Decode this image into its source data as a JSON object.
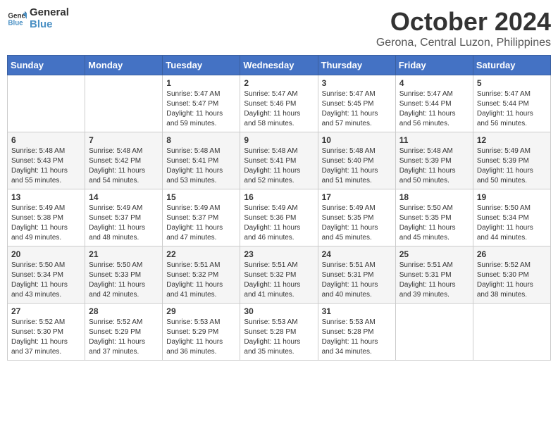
{
  "logo": {
    "line1": "General",
    "line2": "Blue"
  },
  "title": "October 2024",
  "location": "Gerona, Central Luzon, Philippines",
  "days_of_week": [
    "Sunday",
    "Monday",
    "Tuesday",
    "Wednesday",
    "Thursday",
    "Friday",
    "Saturday"
  ],
  "weeks": [
    [
      {
        "day": "",
        "info": ""
      },
      {
        "day": "",
        "info": ""
      },
      {
        "day": "1",
        "info": "Sunrise: 5:47 AM\nSunset: 5:47 PM\nDaylight: 11 hours and 59 minutes."
      },
      {
        "day": "2",
        "info": "Sunrise: 5:47 AM\nSunset: 5:46 PM\nDaylight: 11 hours and 58 minutes."
      },
      {
        "day": "3",
        "info": "Sunrise: 5:47 AM\nSunset: 5:45 PM\nDaylight: 11 hours and 57 minutes."
      },
      {
        "day": "4",
        "info": "Sunrise: 5:47 AM\nSunset: 5:44 PM\nDaylight: 11 hours and 56 minutes."
      },
      {
        "day": "5",
        "info": "Sunrise: 5:47 AM\nSunset: 5:44 PM\nDaylight: 11 hours and 56 minutes."
      }
    ],
    [
      {
        "day": "6",
        "info": "Sunrise: 5:48 AM\nSunset: 5:43 PM\nDaylight: 11 hours and 55 minutes."
      },
      {
        "day": "7",
        "info": "Sunrise: 5:48 AM\nSunset: 5:42 PM\nDaylight: 11 hours and 54 minutes."
      },
      {
        "day": "8",
        "info": "Sunrise: 5:48 AM\nSunset: 5:41 PM\nDaylight: 11 hours and 53 minutes."
      },
      {
        "day": "9",
        "info": "Sunrise: 5:48 AM\nSunset: 5:41 PM\nDaylight: 11 hours and 52 minutes."
      },
      {
        "day": "10",
        "info": "Sunrise: 5:48 AM\nSunset: 5:40 PM\nDaylight: 11 hours and 51 minutes."
      },
      {
        "day": "11",
        "info": "Sunrise: 5:48 AM\nSunset: 5:39 PM\nDaylight: 11 hours and 50 minutes."
      },
      {
        "day": "12",
        "info": "Sunrise: 5:49 AM\nSunset: 5:39 PM\nDaylight: 11 hours and 50 minutes."
      }
    ],
    [
      {
        "day": "13",
        "info": "Sunrise: 5:49 AM\nSunset: 5:38 PM\nDaylight: 11 hours and 49 minutes."
      },
      {
        "day": "14",
        "info": "Sunrise: 5:49 AM\nSunset: 5:37 PM\nDaylight: 11 hours and 48 minutes."
      },
      {
        "day": "15",
        "info": "Sunrise: 5:49 AM\nSunset: 5:37 PM\nDaylight: 11 hours and 47 minutes."
      },
      {
        "day": "16",
        "info": "Sunrise: 5:49 AM\nSunset: 5:36 PM\nDaylight: 11 hours and 46 minutes."
      },
      {
        "day": "17",
        "info": "Sunrise: 5:49 AM\nSunset: 5:35 PM\nDaylight: 11 hours and 45 minutes."
      },
      {
        "day": "18",
        "info": "Sunrise: 5:50 AM\nSunset: 5:35 PM\nDaylight: 11 hours and 45 minutes."
      },
      {
        "day": "19",
        "info": "Sunrise: 5:50 AM\nSunset: 5:34 PM\nDaylight: 11 hours and 44 minutes."
      }
    ],
    [
      {
        "day": "20",
        "info": "Sunrise: 5:50 AM\nSunset: 5:34 PM\nDaylight: 11 hours and 43 minutes."
      },
      {
        "day": "21",
        "info": "Sunrise: 5:50 AM\nSunset: 5:33 PM\nDaylight: 11 hours and 42 minutes."
      },
      {
        "day": "22",
        "info": "Sunrise: 5:51 AM\nSunset: 5:32 PM\nDaylight: 11 hours and 41 minutes."
      },
      {
        "day": "23",
        "info": "Sunrise: 5:51 AM\nSunset: 5:32 PM\nDaylight: 11 hours and 41 minutes."
      },
      {
        "day": "24",
        "info": "Sunrise: 5:51 AM\nSunset: 5:31 PM\nDaylight: 11 hours and 40 minutes."
      },
      {
        "day": "25",
        "info": "Sunrise: 5:51 AM\nSunset: 5:31 PM\nDaylight: 11 hours and 39 minutes."
      },
      {
        "day": "26",
        "info": "Sunrise: 5:52 AM\nSunset: 5:30 PM\nDaylight: 11 hours and 38 minutes."
      }
    ],
    [
      {
        "day": "27",
        "info": "Sunrise: 5:52 AM\nSunset: 5:30 PM\nDaylight: 11 hours and 37 minutes."
      },
      {
        "day": "28",
        "info": "Sunrise: 5:52 AM\nSunset: 5:29 PM\nDaylight: 11 hours and 37 minutes."
      },
      {
        "day": "29",
        "info": "Sunrise: 5:53 AM\nSunset: 5:29 PM\nDaylight: 11 hours and 36 minutes."
      },
      {
        "day": "30",
        "info": "Sunrise: 5:53 AM\nSunset: 5:28 PM\nDaylight: 11 hours and 35 minutes."
      },
      {
        "day": "31",
        "info": "Sunrise: 5:53 AM\nSunset: 5:28 PM\nDaylight: 11 hours and 34 minutes."
      },
      {
        "day": "",
        "info": ""
      },
      {
        "day": "",
        "info": ""
      }
    ]
  ]
}
